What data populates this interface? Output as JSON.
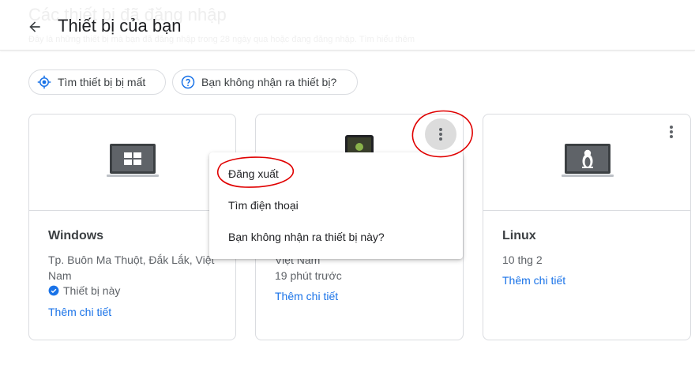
{
  "header": {
    "title": "Thiết bị của bạn",
    "ghost_title": "Các thiết bị đã đăng nhập",
    "ghost_breadcrumb": "Đây là những thiết bị mà bạn đã đăng nhập trong 28 ngày qua hoặc đang đăng nhập. Tìm hiểu thêm"
  },
  "chips": [
    {
      "label": "Tìm thiết bị bị mất",
      "icon": "locate-icon"
    },
    {
      "label": "Bạn không nhận ra thiết bị?",
      "icon": "help-circle-icon"
    }
  ],
  "devices": [
    {
      "name": "Windows",
      "location_line1": "Tp. Buôn Ma Thuột, Đắk Lắk, Việt",
      "location_line2": "Nam",
      "badge": "Thiết bị này",
      "link": "Thêm chi tiết",
      "icon": "windows-laptop-icon"
    },
    {
      "location_line2": "Việt Nam",
      "time": "19 phút trước",
      "link": "Thêm chi tiết",
      "icon": "android-phone-icon"
    },
    {
      "name": "Linux",
      "time": "10 thg 2",
      "link": "Thêm chi tiết",
      "icon": "linux-laptop-icon"
    }
  ],
  "menu": {
    "items": [
      "Đăng xuất",
      "Tìm điện thoại",
      "Bạn không nhận ra thiết bị này?"
    ]
  },
  "colors": {
    "link": "#1a73e8",
    "annotation": "#e00000",
    "verified": "#1a73e8"
  }
}
